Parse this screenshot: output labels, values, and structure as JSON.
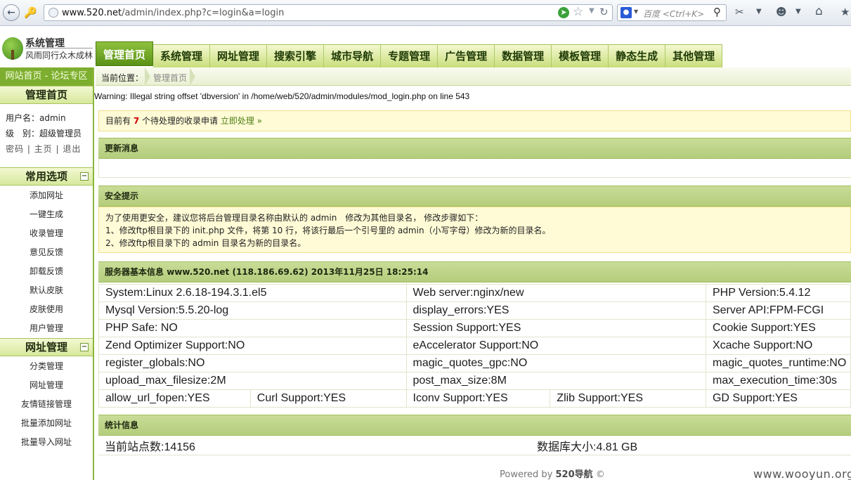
{
  "browser": {
    "url_host": "www.520.net",
    "url_path": "/admin/index.php?c=login&a=login",
    "search_placeholder": "百度 <Ctrl+K>"
  },
  "header": {
    "logo_title": "系统管理",
    "logo_subtitle": "风雨同行众木成林",
    "nav": [
      "管理首页",
      "系统管理",
      "网址管理",
      "搜索引擎",
      "城市导航",
      "专题管理",
      "广告管理",
      "数据管理",
      "模板管理",
      "静态生成",
      "其他管理"
    ]
  },
  "sidebar": {
    "top_link": "网站首页 - 论坛专区",
    "home_title": "管理首页",
    "username_label": "用户名：admin",
    "level_label": "级　别：超级管理员",
    "user_links": "密码 | 主页 | 退出",
    "section1_title": "常用选项",
    "section1_items": [
      "添加网址",
      "一键生成",
      "收录管理",
      "意见反馈",
      "卸载反馈",
      "默认皮肤",
      "皮肤使用",
      "用户管理"
    ],
    "section2_title": "网址管理",
    "section2_items": [
      "分类管理",
      "网址管理",
      "友情链接管理",
      "批量添加网址",
      "批量导入网址"
    ],
    "collapse_glyph": "−"
  },
  "breadcrumb": {
    "label": "当前位置：",
    "current": "管理首页"
  },
  "warning_text": "Warning: Illegal string offset 'dbversion' in /home/web/520/admin/modules/mod_login.php on line 543",
  "notice": {
    "prefix": "目前有 ",
    "count": "7",
    "middle": " 个待处理的收录申请 ",
    "action": "立即处理 »"
  },
  "news": {
    "title": "更新消息"
  },
  "security": {
    "title": "安全提示",
    "line1": "为了使用更安全，建议您将后台管理目录名称由默认的 admin　修改为其他目录名， 修改步骤如下：",
    "line2": "1、修改ftp根目录下的 init.php 文件，将第 10 行，将该行最后一个引号里的 admin（小写字母）修改为新的目录名。",
    "line3": "2、修改ftp根目录下的 admin 目录名为新的目录名。"
  },
  "server": {
    "title": "服务器基本信息",
    "meta": "www.520.net (118.186.69.62)  2013年11月25日 18:25:14",
    "rows": [
      [
        "System:Linux 2.6.18-194.3.1.el5",
        "Web server:nginx/new",
        "PHP Version:5.4.12"
      ],
      [
        "Mysql Version:5.5.20-log",
        "display_errors:YES",
        "Server API:FPM-FCGI"
      ],
      [
        "PHP Safe: NO",
        "Session Support:YES",
        "Cookie Support:YES"
      ],
      [
        "Zend Optimizer Support:NO",
        "eAccelerator Support:NO",
        "Xcache Support:NO"
      ],
      [
        "register_globals:NO",
        "magic_quotes_gpc:NO",
        "magic_quotes_runtime:NO"
      ],
      [
        "upload_max_filesize:2M",
        "post_max_size:8M",
        "max_execution_time:30s"
      ]
    ],
    "last_row": [
      "allow_url_fopen:YES",
      "Curl Support:YES",
      "Iconv Support:YES",
      "Zlib Support:YES",
      "GD Support:YES"
    ]
  },
  "stats": {
    "title": "统计信息",
    "sites": "当前站点数:14156",
    "db_size": "数据库大小:4.81 GB"
  },
  "footer": {
    "prefix": "Powered by ",
    "brand": "520导航",
    "suffix": " ©"
  },
  "watermark": "www.wooyun.org",
  "colors": {
    "accent_green": "#7eae2f",
    "notice_yellow": "#fffbd6",
    "count_red": "#cc0000"
  }
}
